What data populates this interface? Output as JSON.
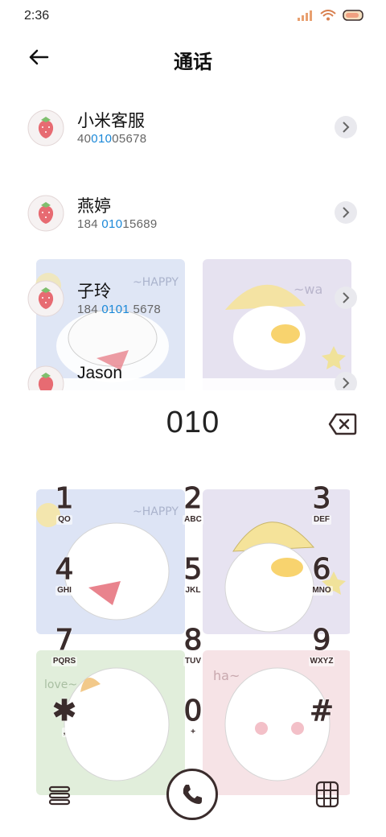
{
  "status_bar": {
    "time": "2:36"
  },
  "header": {
    "title": "通话"
  },
  "contacts": [
    {
      "name": "小米客服",
      "number_pre": "40",
      "number_hl": "010",
      "number_post": "05678"
    },
    {
      "name": "燕婷",
      "number_pre": "184 ",
      "number_hl": "010",
      "number_post": "15689"
    },
    {
      "name": "子玲",
      "number_pre": "184 ",
      "number_hl": "0101",
      "number_post": " 5678"
    },
    {
      "name": "Jason",
      "number_pre": "",
      "number_hl": "",
      "number_post": ""
    }
  ],
  "dial": {
    "number": "010"
  },
  "keys": [
    {
      "digit": "1",
      "letters": "QO"
    },
    {
      "digit": "2",
      "letters": "ABC"
    },
    {
      "digit": "3",
      "letters": "DEF"
    },
    {
      "digit": "4",
      "letters": "GHI"
    },
    {
      "digit": "5",
      "letters": "JKL"
    },
    {
      "digit": "6",
      "letters": "MNO"
    },
    {
      "digit": "7",
      "letters": "PQRS"
    },
    {
      "digit": "8",
      "letters": "TUV"
    },
    {
      "digit": "9",
      "letters": "WXYZ"
    },
    {
      "digit": "✱",
      "letters": ","
    },
    {
      "digit": "0",
      "letters": "+"
    },
    {
      "digit": "#",
      "letters": ""
    }
  ],
  "icons": {
    "back": "back-arrow-icon",
    "delete": "backspace-icon",
    "menu": "menu-icon",
    "call": "phone-icon",
    "dialpad": "dialpad-icon"
  },
  "colors": {
    "highlight": "#1a88d8",
    "ink": "#3a2c2c"
  }
}
